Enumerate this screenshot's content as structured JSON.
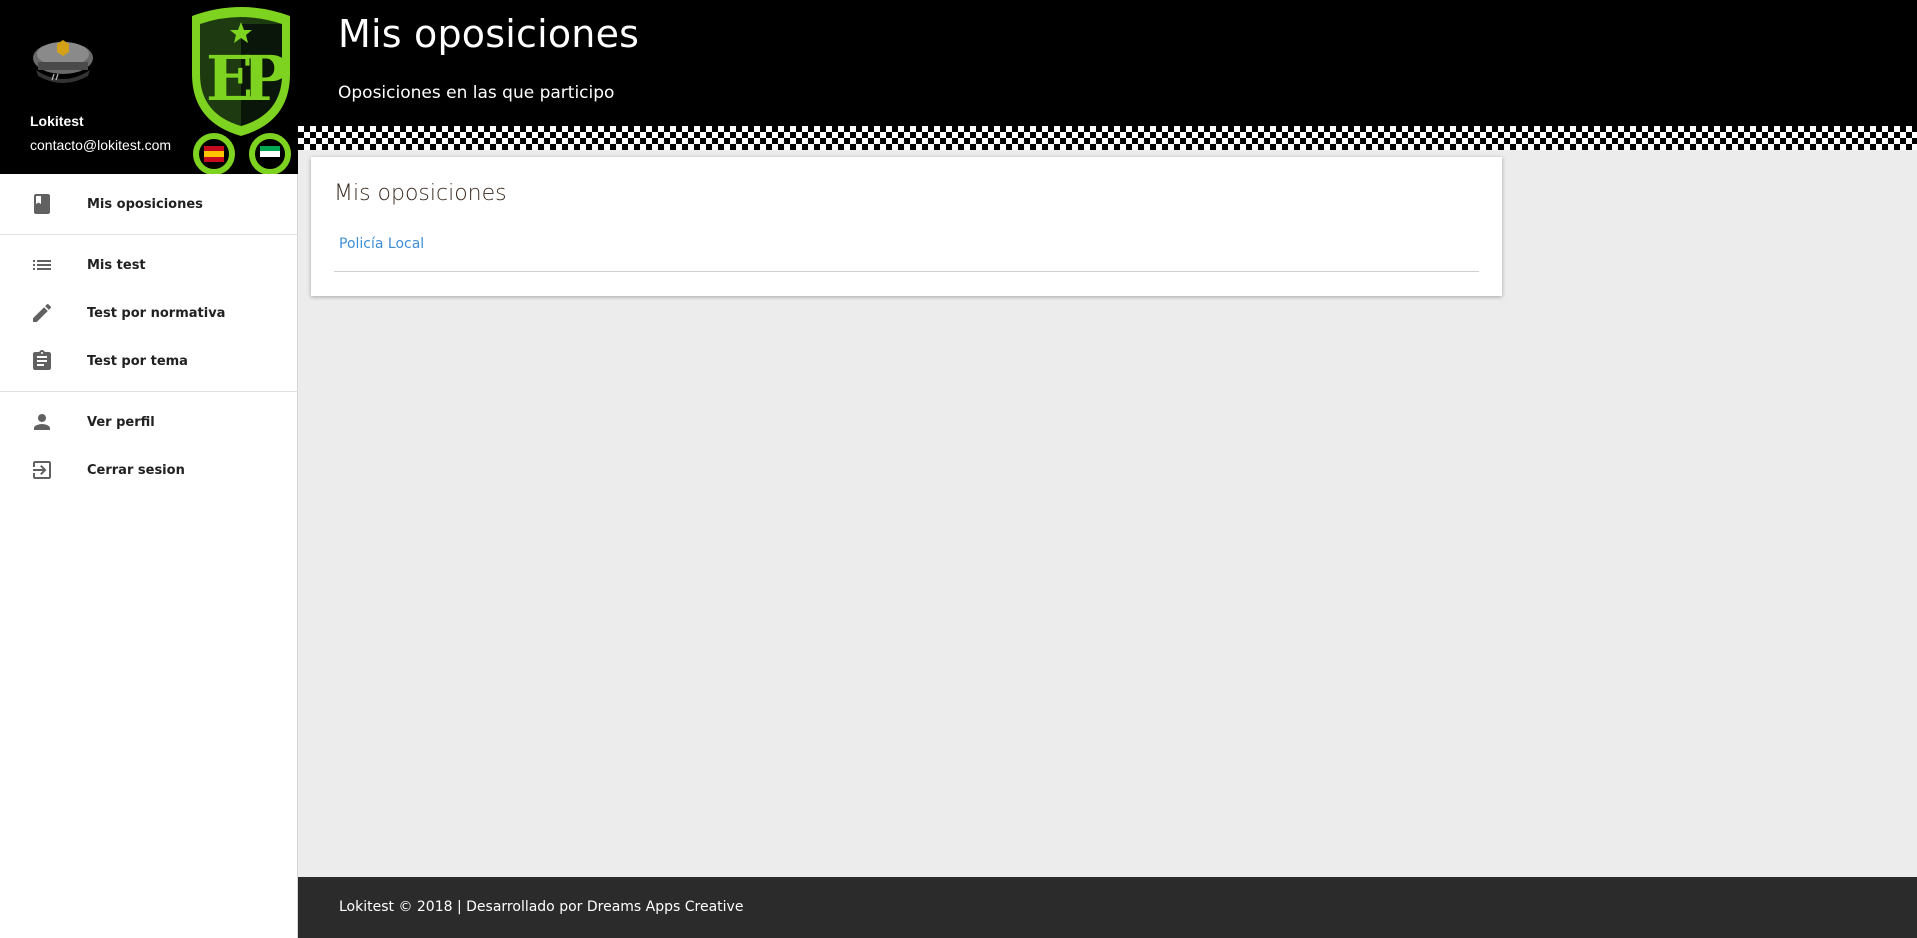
{
  "user": {
    "name": "Lokitest",
    "email": "contacto@lokitest.com"
  },
  "header": {
    "title": "Mis oposiciones",
    "subtitle": "Oposiciones en las que participo"
  },
  "nav": {
    "items": [
      {
        "label": "Mis oposiciones",
        "icon": "book-icon"
      },
      {
        "label": "Mis test",
        "icon": "list-icon"
      },
      {
        "label": "Test por normativa",
        "icon": "pencil-icon"
      },
      {
        "label": "Test por tema",
        "icon": "clipboard-icon"
      },
      {
        "label": "Ver perfil",
        "icon": "person-icon"
      },
      {
        "label": "Cerrar sesion",
        "icon": "logout-icon"
      }
    ]
  },
  "card": {
    "title": "Mis oposiciones",
    "items": [
      {
        "label": "Policía Local"
      }
    ]
  },
  "footer": {
    "text": "Lokitest © 2018 | Desarrollado por Dreams Apps Creative"
  },
  "colors": {
    "header_bg": "#000000",
    "logo_green": "#7ed321",
    "link": "#3f8fd8",
    "footer_bg": "#2b2b2b",
    "content_bg": "#ececec"
  }
}
